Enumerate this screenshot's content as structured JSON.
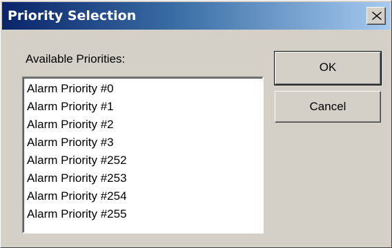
{
  "window": {
    "title": "Priority Selection"
  },
  "titlebar": {
    "close_icon": "close-icon"
  },
  "available_label": "Available Priorities:",
  "priorities": [
    "Alarm Priority #0",
    "Alarm Priority #1",
    "Alarm Priority #2",
    "Alarm Priority #3",
    "Alarm Priority #252",
    "Alarm Priority #253",
    "Alarm Priority #254",
    "Alarm Priority #255"
  ],
  "buttons": {
    "ok_label": "OK",
    "cancel_label": "Cancel"
  }
}
